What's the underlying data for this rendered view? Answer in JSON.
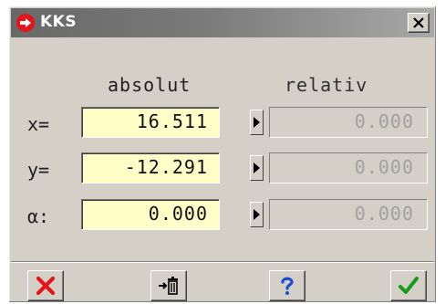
{
  "window": {
    "title": "KKS",
    "close_icon": "close-icon",
    "title_icon": "red-arrow-icon"
  },
  "columns": {
    "absolute": "absolut",
    "relative": "relativ"
  },
  "rows": [
    {
      "label": "x=",
      "absolute": "16.511",
      "relative": "0.000"
    },
    {
      "label": "y=",
      "absolute": "-12.291",
      "relative": "0.000"
    },
    {
      "label": "α:",
      "absolute": "0.000",
      "relative": "0.000"
    }
  ],
  "toolbar": {
    "cancel_icon": "cancel-x-icon",
    "clear_icon": "clear-to-trash-icon",
    "help_icon": "help-icon",
    "ok_icon": "ok-check-icon"
  },
  "colors": {
    "input_bg": "#ffffc8",
    "dialog_bg": "#d4d0c8",
    "cancel": "#e4141b",
    "ok": "#1a9a1a",
    "help": "#1c4fd0"
  }
}
